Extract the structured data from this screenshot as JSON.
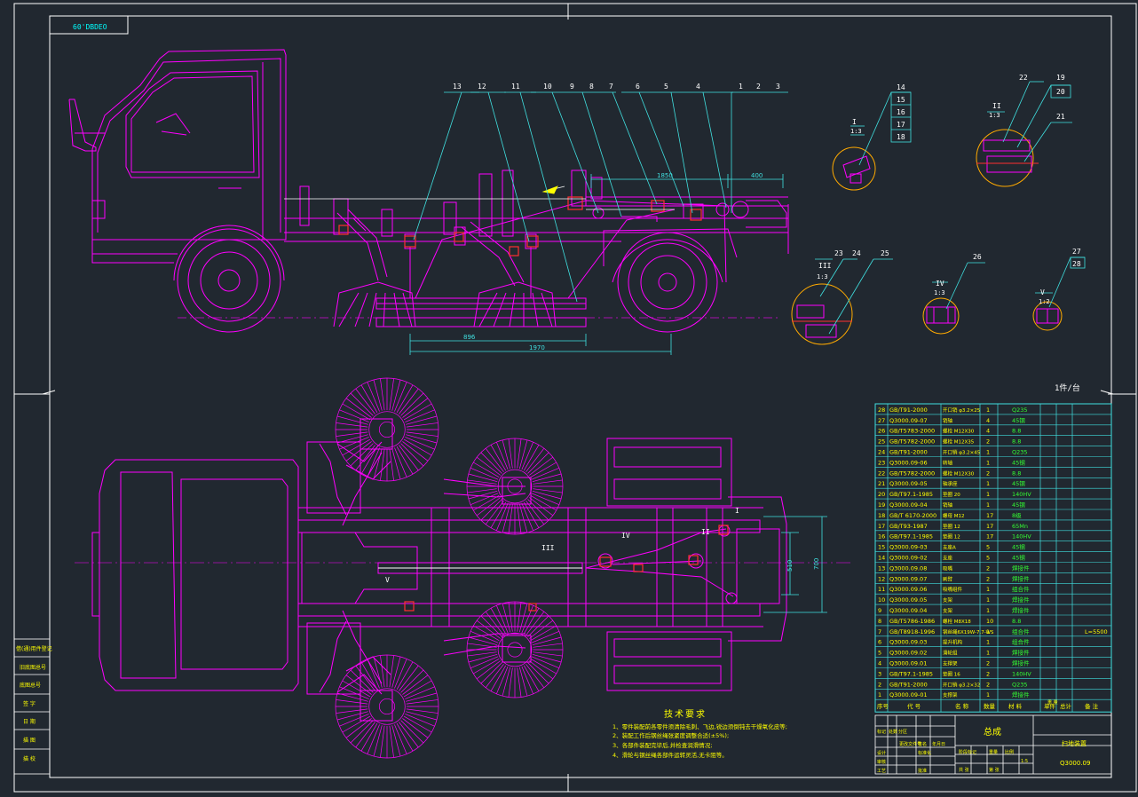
{
  "drawing_code": "60'DBDEO",
  "callouts_side": [
    "13",
    "12",
    "11",
    "10",
    "9",
    "8",
    "7",
    "6",
    "5",
    "4",
    "1",
    "2",
    "3"
  ],
  "dims_side": {
    "d1": "1850",
    "d2": "400",
    "d3": "896",
    "d4": "1970"
  },
  "dims_top": {
    "d1": "510",
    "d2": "700"
  },
  "detail_I": {
    "roman": "I",
    "scale": "1:3",
    "callouts": [
      "14",
      "15",
      "16",
      "17",
      "18"
    ]
  },
  "detail_II": {
    "roman": "II",
    "scale": "1:3",
    "callouts": [
      "22",
      "19",
      "20",
      "21"
    ]
  },
  "detail_III": {
    "roman": "III",
    "scale": "1:3",
    "callouts": [
      "23",
      "24",
      "25"
    ]
  },
  "detail_IV": {
    "roman": "IV",
    "scale": "1:3",
    "callouts": [
      "26"
    ]
  },
  "detail_V": {
    "roman": "V",
    "scale": "1:2",
    "callouts": [
      "27",
      "28"
    ]
  },
  "top_labels": [
    "V",
    "III",
    "IV",
    "II",
    "I"
  ],
  "per_unit": "1件/台",
  "bom_rows": [
    {
      "no": "28",
      "code": "GB/T91-2000",
      "name": "开口销 φ3.2×25",
      "qty": "1",
      "mat": "Q235",
      "note": ""
    },
    {
      "no": "27",
      "code": "Q3000.09-07",
      "name": "销轴",
      "qty": "4",
      "mat": "45钢",
      "note": ""
    },
    {
      "no": "26",
      "code": "GB/T5783-2000",
      "name": "螺栓 M12X30",
      "qty": "4",
      "mat": "8.8",
      "note": ""
    },
    {
      "no": "25",
      "code": "GB/T5782-2000",
      "name": "螺栓 M12X35",
      "qty": "2",
      "mat": "8.8",
      "note": ""
    },
    {
      "no": "24",
      "code": "GB/T91-2000",
      "name": "开口销 φ3.2×45",
      "qty": "1",
      "mat": "Q235",
      "note": ""
    },
    {
      "no": "23",
      "code": "Q3000.09-06",
      "name": "转轴",
      "qty": "1",
      "mat": "45钢",
      "note": ""
    },
    {
      "no": "22",
      "code": "GB/T5782-2000",
      "name": "螺栓 M12X30",
      "qty": "2",
      "mat": "8.8",
      "note": ""
    },
    {
      "no": "21",
      "code": "Q3000.09-05",
      "name": "轴承座",
      "qty": "1",
      "mat": "45钢",
      "note": ""
    },
    {
      "no": "20",
      "code": "GB/T97.1-1985",
      "name": "垫圈 20",
      "qty": "1",
      "mat": "140HV",
      "note": ""
    },
    {
      "no": "19",
      "code": "Q3000.09-04",
      "name": "销轴",
      "qty": "1",
      "mat": "45钢",
      "note": ""
    },
    {
      "no": "18",
      "code": "GB/T 6170-2000",
      "name": "螺母 M12",
      "qty": "17",
      "mat": "8级",
      "note": ""
    },
    {
      "no": "17",
      "code": "GB/T93-1987",
      "name": "垫圈 12",
      "qty": "17",
      "mat": "65Mn",
      "note": ""
    },
    {
      "no": "16",
      "code": "GB/T97.1-1985",
      "name": "垫圈 12",
      "qty": "17",
      "mat": "140HV",
      "note": ""
    },
    {
      "no": "15",
      "code": "Q3000.09-03",
      "name": "支座A",
      "qty": "5",
      "mat": "45钢",
      "note": ""
    },
    {
      "no": "14",
      "code": "Q3000.09-02",
      "name": "支座",
      "qty": "5",
      "mat": "45钢",
      "note": ""
    },
    {
      "no": "13",
      "code": "Q3000.09.08",
      "name": "吸嘴",
      "qty": "2",
      "mat": "焊接件",
      "note": ""
    },
    {
      "no": "12",
      "code": "Q3000.09.07",
      "name": "刷臂",
      "qty": "2",
      "mat": "焊接件",
      "note": ""
    },
    {
      "no": "11",
      "code": "Q3000.09.06",
      "name": "吸嘴组件",
      "qty": "1",
      "mat": "组合件",
      "note": ""
    },
    {
      "no": "10",
      "code": "Q3000.09.05",
      "name": "支架",
      "qty": "1",
      "mat": "焊接件",
      "note": ""
    },
    {
      "no": "9",
      "code": "Q3000.09.04",
      "name": "支架",
      "qty": "1",
      "mat": "焊接件",
      "note": ""
    },
    {
      "no": "8",
      "code": "GB/T5786-1986",
      "name": "螺栓 M8X18",
      "qty": "10",
      "mat": "8.8",
      "note": ""
    },
    {
      "no": "7",
      "code": "GB/T8918-1996",
      "name": "钢丝绳6X19W-7.7-WS",
      "qty": "1",
      "mat": "组合件",
      "note": "L=5500"
    },
    {
      "no": "6",
      "code": "Q3000.09.03",
      "name": "提升机构",
      "qty": "1",
      "mat": "组合件",
      "note": ""
    },
    {
      "no": "5",
      "code": "Q3000.09.02",
      "name": "滑轮组",
      "qty": "1",
      "mat": "焊接件",
      "note": ""
    },
    {
      "no": "4",
      "code": "Q3000.09.01",
      "name": "支撑架",
      "qty": "2",
      "mat": "焊接件",
      "note": ""
    },
    {
      "no": "3",
      "code": "GB/T97.1-1985",
      "name": "垫圈 16",
      "qty": "2",
      "mat": "140HV",
      "note": ""
    },
    {
      "no": "2",
      "code": "GB/T91-2000",
      "name": "开口销 φ3.2×32",
      "qty": "2",
      "mat": "Q235",
      "note": ""
    },
    {
      "no": "1",
      "code": "Q3000.09-01",
      "name": "支撑架",
      "qty": "1",
      "mat": "焊接件",
      "note": ""
    }
  ],
  "bom_header": [
    "序号",
    "代 号",
    "名 称",
    "数量",
    "材 料",
    "单件",
    "总计",
    "备 注"
  ],
  "bom_weight_header": "重 量",
  "tech_title": "技术要求",
  "tech_items": [
    "1、零件装配前各零件须清除毛刺、飞边,锐边须倒钝去干燥氧化皮等;",
    "2、装配工作后钢丝绳张紧度调整合适(±5%);",
    "3、各部件装配完毕后,并检查润滑情况;",
    "4、滑轮与钢丝绳各部件运转灵活,无卡阻等。"
  ],
  "left_strip": [
    "借(通)用件登记",
    "旧底图总号",
    "底图总号",
    "签 字",
    "日 期",
    "描 图",
    "描 校"
  ],
  "title_block": {
    "name": "总成",
    "sub": "扫地装置",
    "code": "Q3000.09",
    "grid": [
      "标记",
      "处数",
      "分区",
      "更改文件号",
      "签名",
      "年月日",
      "设计",
      "标准化",
      "审核",
      "工艺",
      "批准",
      "阶段标记",
      "重量",
      "比例",
      "共 张",
      "第 张",
      "1:5"
    ]
  },
  "colors": {
    "bg": "#212830",
    "frame": "#ffffff",
    "drawing": "#ff00ff",
    "leader": "#40e0e0",
    "dim": "#40e0e0",
    "table": "#40e0e0",
    "table_text_yellow": "#ffff00",
    "table_text_green": "#33ff33"
  }
}
